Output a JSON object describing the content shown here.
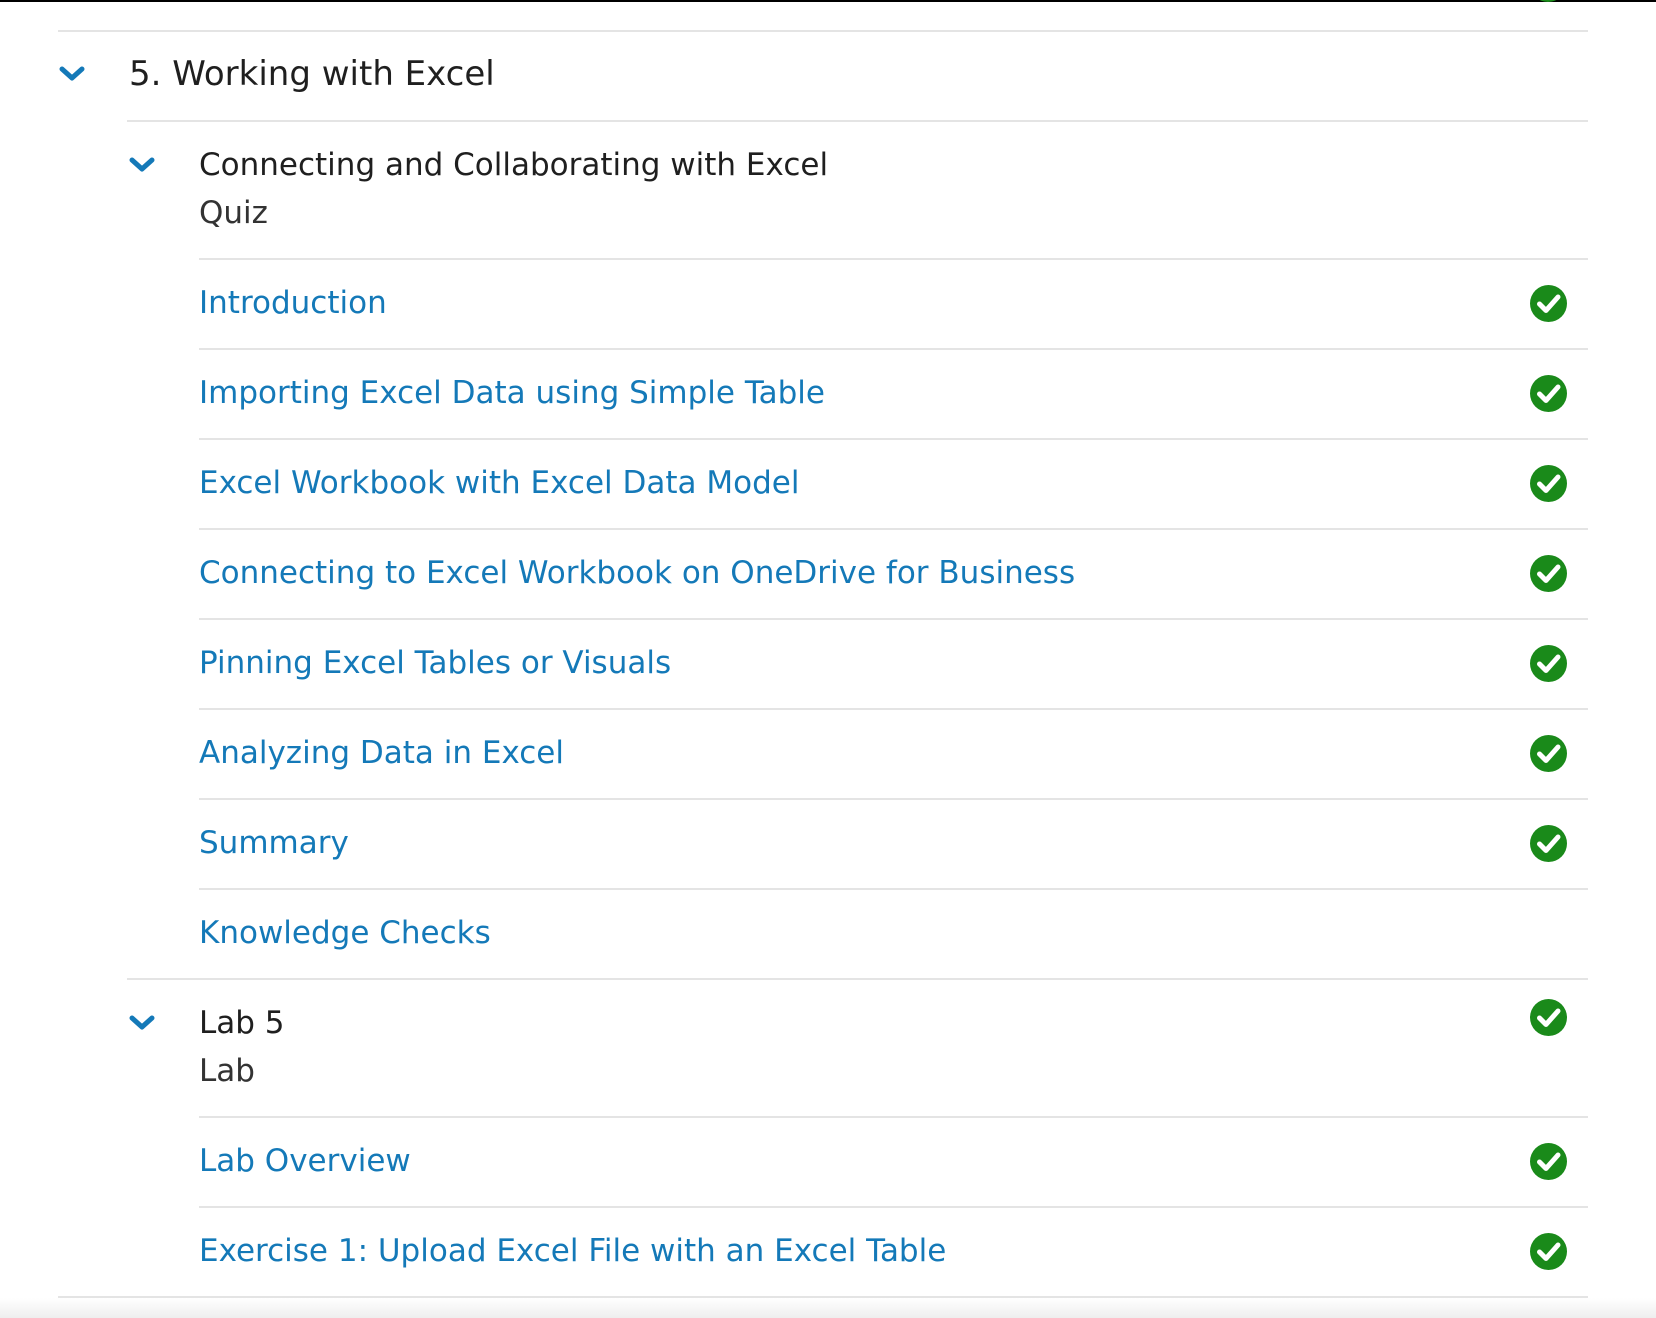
{
  "colors": {
    "accent": "#1479b8",
    "check_green": "#1a8a1a",
    "divider": "#e4e4e4",
    "text": "#1f1f1f"
  },
  "module": {
    "title": "5. Working with Excel",
    "icon": "chevron-down-icon"
  },
  "lessons": [
    {
      "title": "Connecting and Collaborating with Excel",
      "type": "Quiz",
      "completed": false,
      "items": [
        {
          "label": "Introduction",
          "completed": true
        },
        {
          "label": "Importing Excel Data using Simple Table",
          "completed": true
        },
        {
          "label": "Excel Workbook with Excel Data Model",
          "completed": true
        },
        {
          "label": "Connecting to Excel Workbook on OneDrive for Business",
          "completed": true
        },
        {
          "label": "Pinning Excel Tables or Visuals",
          "completed": true
        },
        {
          "label": "Analyzing Data in Excel",
          "completed": true
        },
        {
          "label": "Summary",
          "completed": true
        },
        {
          "label": "Knowledge Checks",
          "completed": false
        }
      ]
    },
    {
      "title": "Lab 5",
      "type": "Lab",
      "completed": true,
      "items": [
        {
          "label": "Lab Overview",
          "completed": true
        },
        {
          "label": "Exercise 1: Upload Excel File with an Excel Table",
          "completed": true
        }
      ]
    }
  ]
}
